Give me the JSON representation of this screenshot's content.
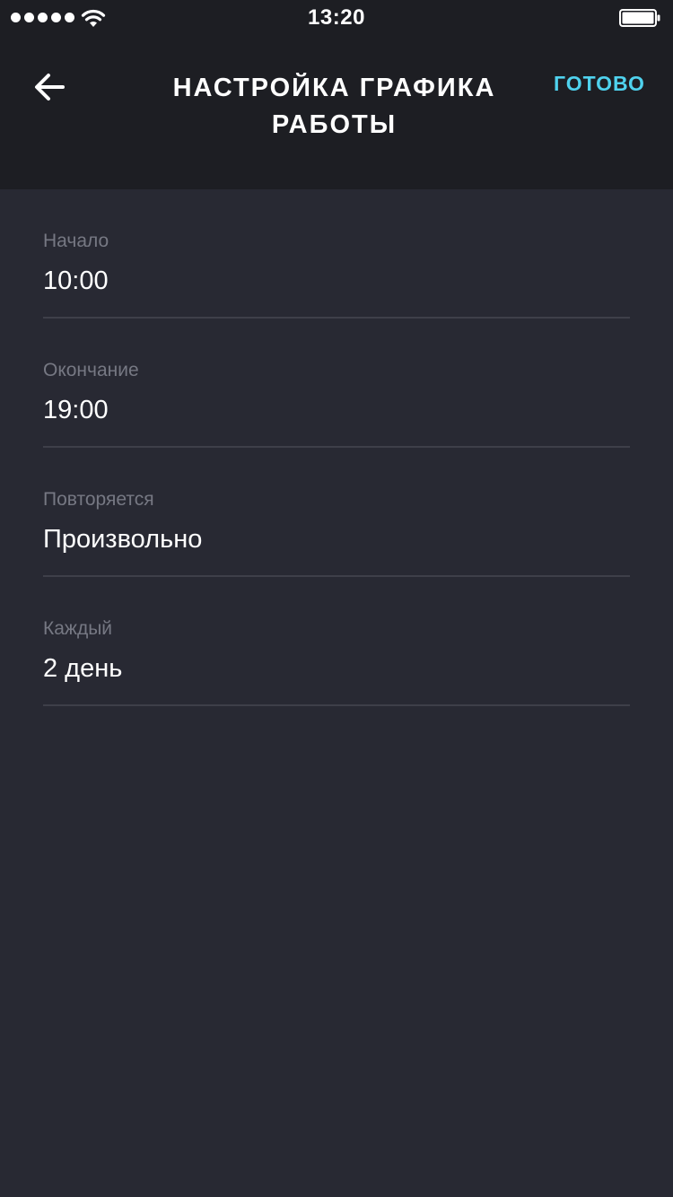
{
  "status_bar": {
    "time": "13:20",
    "signal_icon": "signal-dots-icon",
    "wifi_icon": "wifi-icon",
    "battery_icon": "battery-icon"
  },
  "header": {
    "back_icon": "arrow-left-icon",
    "title": "НАСТРОЙКА ГРАФИКА РАБОТЫ",
    "done_label": "ГОТОВО"
  },
  "fields": [
    {
      "label": "Начало",
      "value": "10:00"
    },
    {
      "label": "Окончание",
      "value": "19:00"
    },
    {
      "label": "Повторяется",
      "value": "Произвольно"
    },
    {
      "label": "Каждый",
      "value": "2 день"
    }
  ],
  "colors": {
    "background": "#282933",
    "header_background": "#1d1e23",
    "accent": "#4fd2ee",
    "label": "#767883",
    "divider": "#3e3f49"
  }
}
